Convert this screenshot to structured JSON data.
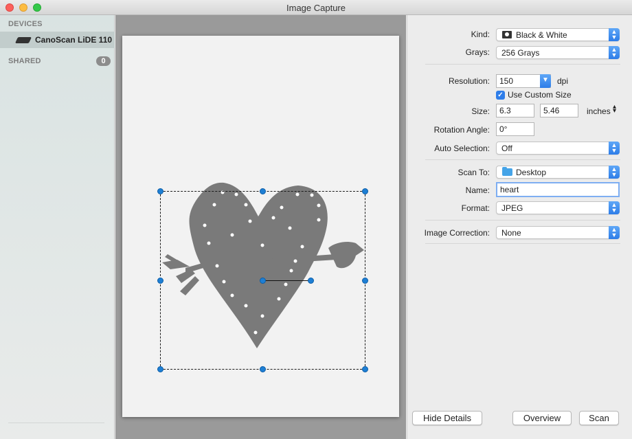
{
  "window": {
    "title": "Image Capture"
  },
  "sidebar": {
    "devices_heading": "DEVICES",
    "devices": [
      {
        "label": "CanoScan LiDE 110",
        "icon": "scanner-icon"
      }
    ],
    "shared_heading": "SHARED",
    "shared_count": "0"
  },
  "settings": {
    "kind": {
      "label": "Kind:",
      "value": "Black & White"
    },
    "grays": {
      "label": "Grays:",
      "value": "256 Grays"
    },
    "resolution": {
      "label": "Resolution:",
      "value": "150",
      "unit": "dpi"
    },
    "custom_size": {
      "label": "Use Custom Size",
      "checked": true
    },
    "size": {
      "label": "Size:",
      "width": "6.3",
      "height": "5.46",
      "unit": "inches"
    },
    "rotation": {
      "label": "Rotation Angle:",
      "value": "0°"
    },
    "auto_selection": {
      "label": "Auto Selection:",
      "value": "Off"
    },
    "scan_to": {
      "label": "Scan To:",
      "value": "Desktop"
    },
    "name": {
      "label": "Name:",
      "value": "heart"
    },
    "format": {
      "label": "Format:",
      "value": "JPEG"
    },
    "image_correction": {
      "label": "Image Correction:",
      "value": "None"
    }
  },
  "buttons": {
    "hide_details": "Hide Details",
    "overview": "Overview",
    "scan": "Scan"
  },
  "colors": {
    "accent": "#2d7de8",
    "handle": "#1e7fd4",
    "artwork": "#7a7a7a",
    "paper": "#f2f2f2"
  }
}
